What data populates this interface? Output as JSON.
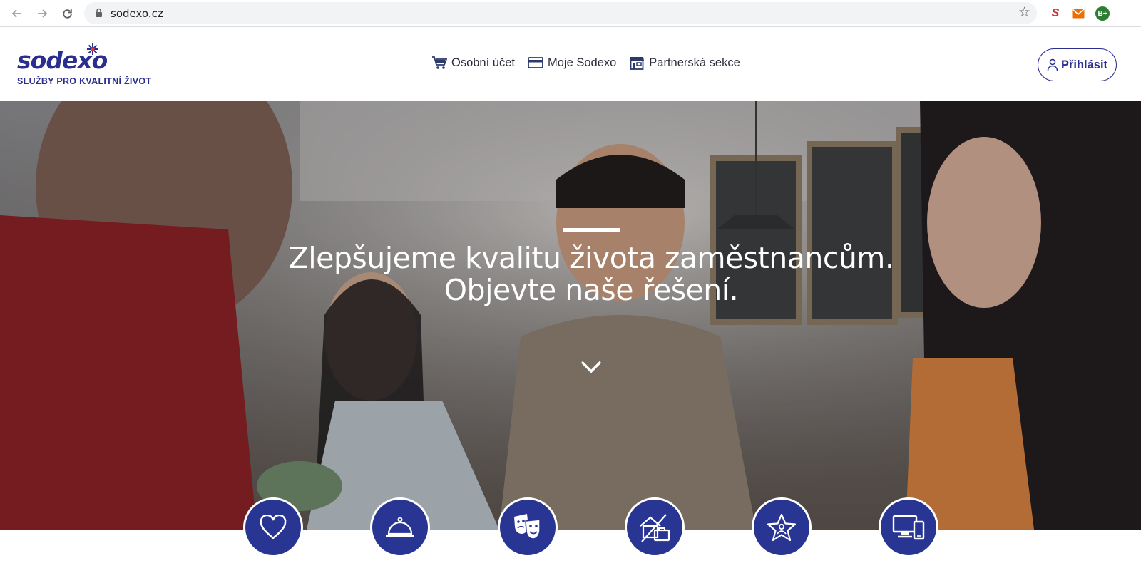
{
  "browser": {
    "url": "sodexo.cz",
    "nav_icons": [
      "back-arrow-icon",
      "forward-arrow-icon",
      "reload-icon"
    ],
    "extensions": [
      "sodexo-extension-icon",
      "mail-extension-icon",
      "badge-extension-icon"
    ],
    "extension_badge_text": "B+"
  },
  "header": {
    "logo": {
      "wordmark": "sodexo",
      "tagline": "SLUŽBY PRO KVALITNÍ ŽIVOT"
    },
    "nav": [
      {
        "label": "Osobní účet",
        "icon": "shopping-cart-icon"
      },
      {
        "label": "Moje Sodexo",
        "icon": "credit-card-icon"
      },
      {
        "label": "Partnerská sekce",
        "icon": "storefront-icon"
      }
    ],
    "login": {
      "label": "Přihlásit",
      "icon": "user-icon"
    }
  },
  "hero": {
    "title_line1": "Zlepšujeme kvalitu života zaměstnancům.",
    "title_line2": "Objevte naše řešení.",
    "scroll_icon": "chevron-down-icon"
  },
  "categories": [
    {
      "icon": "heart-icon"
    },
    {
      "icon": "cloche-icon"
    },
    {
      "icon": "theater-masks-icon"
    },
    {
      "icon": "home-office-icon"
    },
    {
      "icon": "star-person-icon"
    },
    {
      "icon": "devices-icon"
    }
  ],
  "colors": {
    "brand_blue": "#283593",
    "logo_blue": "#2a2e8e",
    "logo_star": "#e53935",
    "chrome_bg": "#f1f3f4"
  }
}
